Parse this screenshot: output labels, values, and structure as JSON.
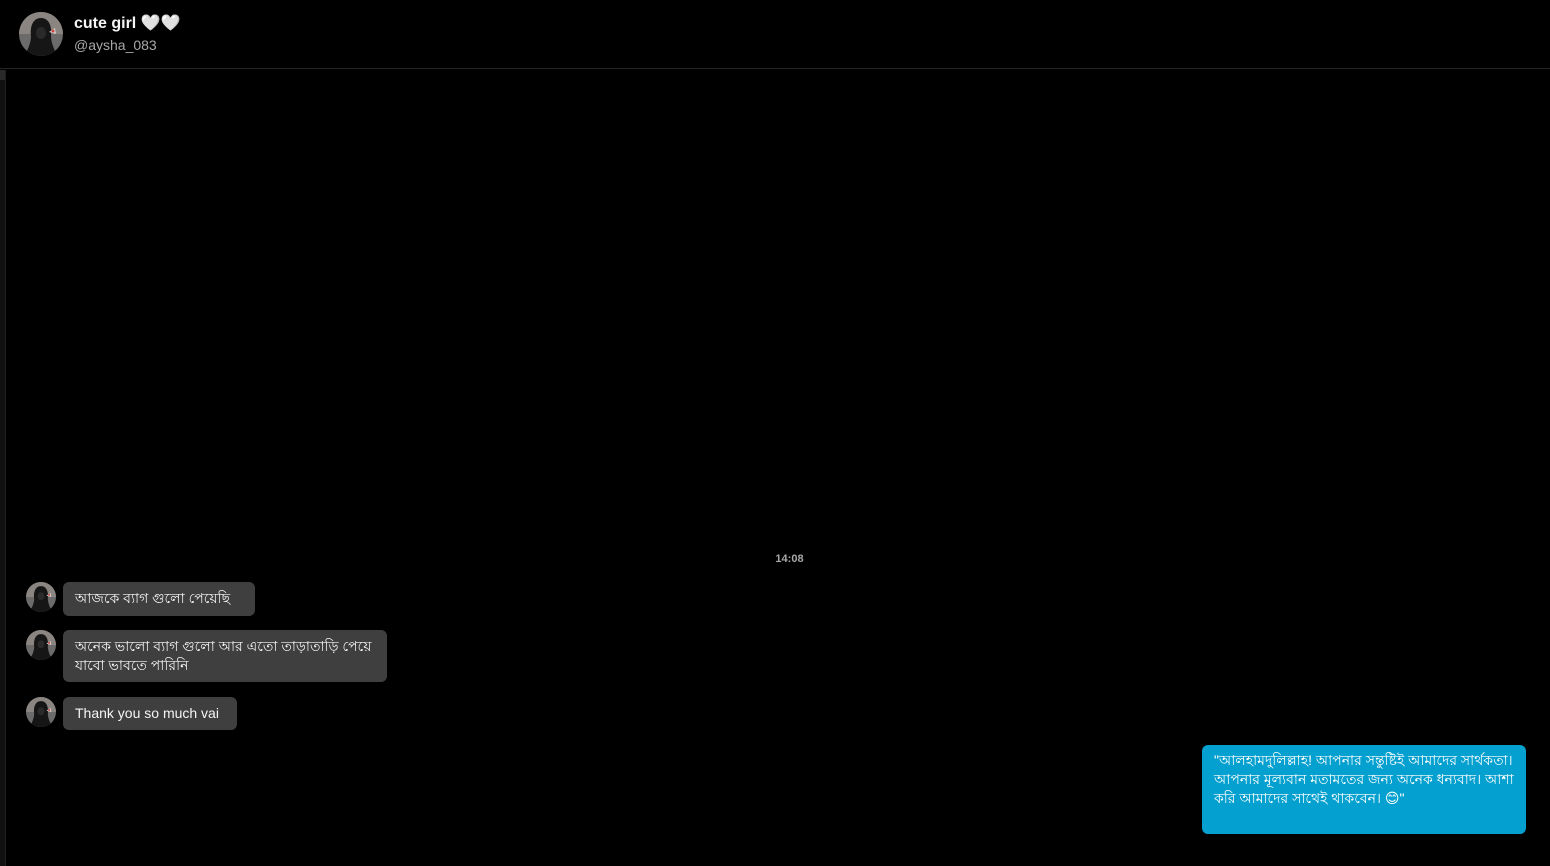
{
  "header": {
    "name": "cute girl 🤍🤍",
    "handle": "@aysha_083"
  },
  "conversation": {
    "timestamp": "14:08",
    "incoming": [
      {
        "text": "আজকে ব্যাগ গুলো পেয়েছি"
      },
      {
        "text": "অনেক ভালো ব্যাগ গুলো আর এতো তাড়াতাড়ি পেয়ে যাবো ভাবতে পারিনি"
      },
      {
        "text": "Thank you so much vai"
      }
    ],
    "outgoing": [
      {
        "text": "\"আলহামদুলিল্লাহ! আপনার সন্তুষ্টিই আমাদের সার্থকতা। আপনার মূল্যবান মতামতের জন্য অনেক ধন্যবাদ। আশা করি আমাদের সাথেই থাকবেন। 😊\""
      }
    ]
  },
  "colors": {
    "background": "#000000",
    "incoming_bubble": "#3f3f3f",
    "outgoing_bubble": "#04a0cf",
    "secondary_text": "#a8a8a8"
  },
  "icons": {
    "avatar": "profile-avatar-hijab-silhouette"
  }
}
